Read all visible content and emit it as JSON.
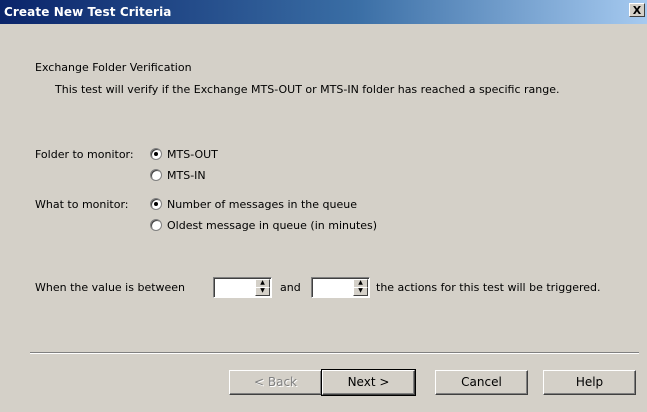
{
  "window": {
    "title": "Create New Test Criteria",
    "close_glyph": "X"
  },
  "header": {
    "heading": "Exchange Folder Verification",
    "description": "This test will verify if the Exchange MTS-OUT or MTS-IN folder has reached a specific range."
  },
  "folder_group": {
    "label": "Folder to monitor:",
    "options": [
      "MTS-OUT",
      "MTS-IN"
    ],
    "selected": "MTS-OUT"
  },
  "monitor_group": {
    "label": "What to monitor:",
    "options": [
      "Number of messages in the queue",
      "Oldest message in queue (in minutes)"
    ],
    "selected": "Number of messages in the queue"
  },
  "range": {
    "prefix": "When the value is between",
    "conjunction": "and",
    "suffix": "the actions for this test will be triggered.",
    "min_value": "",
    "max_value": ""
  },
  "buttons": {
    "back": "< Back",
    "next": "Next >",
    "cancel": "Cancel",
    "help": "Help"
  },
  "icons": {
    "close": "close-icon",
    "spin_up": "arrow-up-icon",
    "spin_down": "arrow-down-icon"
  },
  "colors": {
    "titlebar_start": "#0a246a",
    "titlebar_end": "#a6caf0",
    "dialog_face": "#d4d0c8"
  }
}
